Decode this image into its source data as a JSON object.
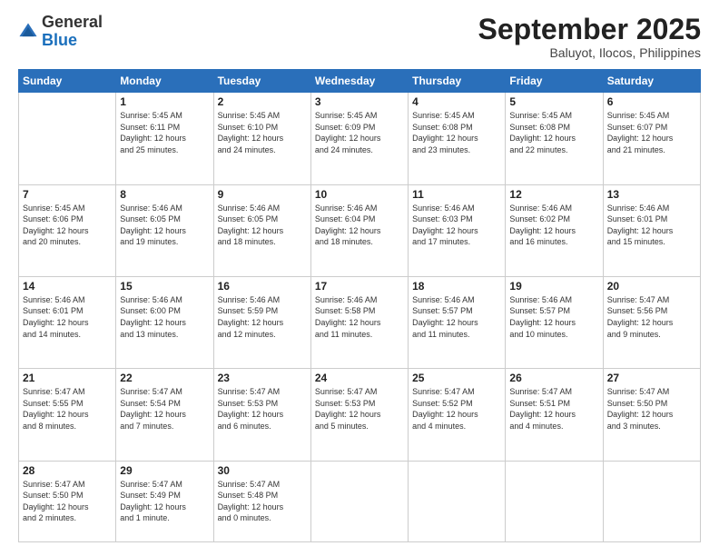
{
  "header": {
    "logo_general": "General",
    "logo_blue": "Blue",
    "month_title": "September 2025",
    "subtitle": "Baluyot, Ilocos, Philippines"
  },
  "days_of_week": [
    "Sunday",
    "Monday",
    "Tuesday",
    "Wednesday",
    "Thursday",
    "Friday",
    "Saturday"
  ],
  "weeks": [
    [
      {
        "day": "",
        "info": ""
      },
      {
        "day": "1",
        "info": "Sunrise: 5:45 AM\nSunset: 6:11 PM\nDaylight: 12 hours\nand 25 minutes."
      },
      {
        "day": "2",
        "info": "Sunrise: 5:45 AM\nSunset: 6:10 PM\nDaylight: 12 hours\nand 24 minutes."
      },
      {
        "day": "3",
        "info": "Sunrise: 5:45 AM\nSunset: 6:09 PM\nDaylight: 12 hours\nand 24 minutes."
      },
      {
        "day": "4",
        "info": "Sunrise: 5:45 AM\nSunset: 6:08 PM\nDaylight: 12 hours\nand 23 minutes."
      },
      {
        "day": "5",
        "info": "Sunrise: 5:45 AM\nSunset: 6:08 PM\nDaylight: 12 hours\nand 22 minutes."
      },
      {
        "day": "6",
        "info": "Sunrise: 5:45 AM\nSunset: 6:07 PM\nDaylight: 12 hours\nand 21 minutes."
      }
    ],
    [
      {
        "day": "7",
        "info": "Sunrise: 5:45 AM\nSunset: 6:06 PM\nDaylight: 12 hours\nand 20 minutes."
      },
      {
        "day": "8",
        "info": "Sunrise: 5:46 AM\nSunset: 6:05 PM\nDaylight: 12 hours\nand 19 minutes."
      },
      {
        "day": "9",
        "info": "Sunrise: 5:46 AM\nSunset: 6:05 PM\nDaylight: 12 hours\nand 18 minutes."
      },
      {
        "day": "10",
        "info": "Sunrise: 5:46 AM\nSunset: 6:04 PM\nDaylight: 12 hours\nand 18 minutes."
      },
      {
        "day": "11",
        "info": "Sunrise: 5:46 AM\nSunset: 6:03 PM\nDaylight: 12 hours\nand 17 minutes."
      },
      {
        "day": "12",
        "info": "Sunrise: 5:46 AM\nSunset: 6:02 PM\nDaylight: 12 hours\nand 16 minutes."
      },
      {
        "day": "13",
        "info": "Sunrise: 5:46 AM\nSunset: 6:01 PM\nDaylight: 12 hours\nand 15 minutes."
      }
    ],
    [
      {
        "day": "14",
        "info": "Sunrise: 5:46 AM\nSunset: 6:01 PM\nDaylight: 12 hours\nand 14 minutes."
      },
      {
        "day": "15",
        "info": "Sunrise: 5:46 AM\nSunset: 6:00 PM\nDaylight: 12 hours\nand 13 minutes."
      },
      {
        "day": "16",
        "info": "Sunrise: 5:46 AM\nSunset: 5:59 PM\nDaylight: 12 hours\nand 12 minutes."
      },
      {
        "day": "17",
        "info": "Sunrise: 5:46 AM\nSunset: 5:58 PM\nDaylight: 12 hours\nand 11 minutes."
      },
      {
        "day": "18",
        "info": "Sunrise: 5:46 AM\nSunset: 5:57 PM\nDaylight: 12 hours\nand 11 minutes."
      },
      {
        "day": "19",
        "info": "Sunrise: 5:46 AM\nSunset: 5:57 PM\nDaylight: 12 hours\nand 10 minutes."
      },
      {
        "day": "20",
        "info": "Sunrise: 5:47 AM\nSunset: 5:56 PM\nDaylight: 12 hours\nand 9 minutes."
      }
    ],
    [
      {
        "day": "21",
        "info": "Sunrise: 5:47 AM\nSunset: 5:55 PM\nDaylight: 12 hours\nand 8 minutes."
      },
      {
        "day": "22",
        "info": "Sunrise: 5:47 AM\nSunset: 5:54 PM\nDaylight: 12 hours\nand 7 minutes."
      },
      {
        "day": "23",
        "info": "Sunrise: 5:47 AM\nSunset: 5:53 PM\nDaylight: 12 hours\nand 6 minutes."
      },
      {
        "day": "24",
        "info": "Sunrise: 5:47 AM\nSunset: 5:53 PM\nDaylight: 12 hours\nand 5 minutes."
      },
      {
        "day": "25",
        "info": "Sunrise: 5:47 AM\nSunset: 5:52 PM\nDaylight: 12 hours\nand 4 minutes."
      },
      {
        "day": "26",
        "info": "Sunrise: 5:47 AM\nSunset: 5:51 PM\nDaylight: 12 hours\nand 4 minutes."
      },
      {
        "day": "27",
        "info": "Sunrise: 5:47 AM\nSunset: 5:50 PM\nDaylight: 12 hours\nand 3 minutes."
      }
    ],
    [
      {
        "day": "28",
        "info": "Sunrise: 5:47 AM\nSunset: 5:50 PM\nDaylight: 12 hours\nand 2 minutes."
      },
      {
        "day": "29",
        "info": "Sunrise: 5:47 AM\nSunset: 5:49 PM\nDaylight: 12 hours\nand 1 minute."
      },
      {
        "day": "30",
        "info": "Sunrise: 5:47 AM\nSunset: 5:48 PM\nDaylight: 12 hours\nand 0 minutes."
      },
      {
        "day": "",
        "info": ""
      },
      {
        "day": "",
        "info": ""
      },
      {
        "day": "",
        "info": ""
      },
      {
        "day": "",
        "info": ""
      }
    ]
  ]
}
